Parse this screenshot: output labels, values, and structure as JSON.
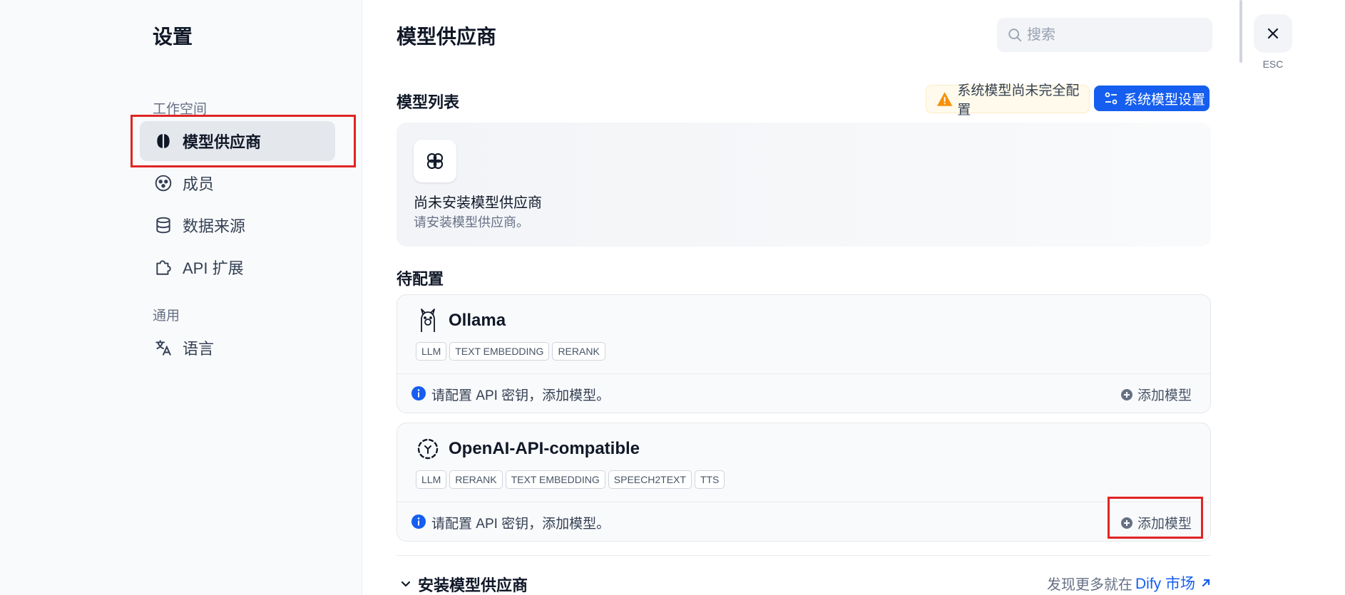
{
  "sidebar": {
    "title": "设置",
    "workspace_label": "工作空间",
    "general_label": "通用",
    "items": [
      {
        "label": "模型供应商",
        "icon": "brain-icon"
      },
      {
        "label": "成员",
        "icon": "members-icon"
      },
      {
        "label": "数据来源",
        "icon": "database-icon"
      },
      {
        "label": "API 扩展",
        "icon": "puzzle-icon"
      },
      {
        "label": "语言",
        "icon": "translate-icon"
      }
    ]
  },
  "header": {
    "title": "模型供应商",
    "search_placeholder": "搜索",
    "esc_label": "ESC"
  },
  "model_list": {
    "label": "模型列表",
    "warning": "系统模型尚未完全配置",
    "settings_button": "系统模型设置",
    "empty_title": "尚未安装模型供应商",
    "empty_desc": "请安装模型供应商。"
  },
  "pending": {
    "label": "待配置",
    "providers": [
      {
        "name": "Ollama",
        "icon": "llama-icon",
        "tags": [
          "LLM",
          "TEXT EMBEDDING",
          "RERANK"
        ],
        "hint": "请配置 API 密钥，添加模型。",
        "add_label": "添加模型"
      },
      {
        "name": "OpenAI-API-compatible",
        "icon": "openai-compatible-icon",
        "tags": [
          "LLM",
          "RERANK",
          "TEXT EMBEDDING",
          "SPEECH2TEXT",
          "TTS"
        ],
        "hint": "请配置 API 密钥，添加模型。",
        "add_label": "添加模型"
      }
    ]
  },
  "install": {
    "label": "安装模型供应商",
    "market_prefix": "发现更多就在",
    "market_link": "Dify 市场"
  },
  "colors": {
    "accent": "#155eef",
    "highlight": "#e02424",
    "warning": "#f79009"
  }
}
